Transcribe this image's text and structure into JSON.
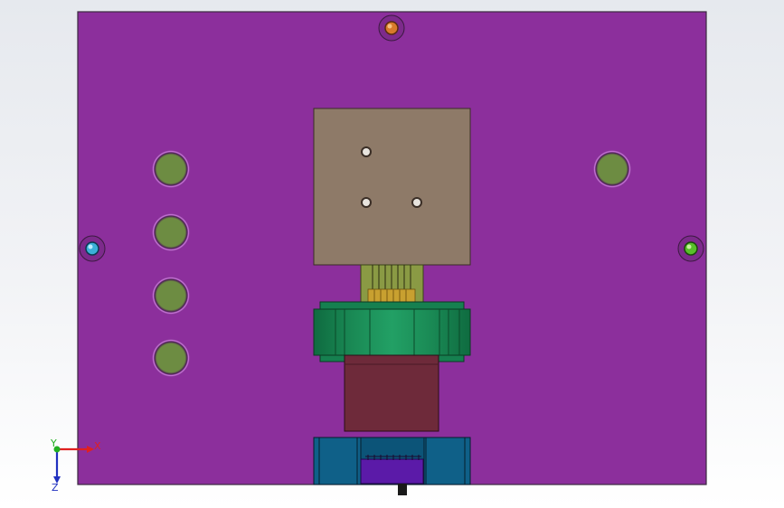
{
  "viewport": {
    "background_top": "#e6e9ee",
    "background_bottom": "#ffffff"
  },
  "part": {
    "plate_color": "#8c2f9c",
    "plate_edge_color": "#3b2a3f",
    "hole_fill_color": "#6d8c42",
    "hole_ring_color": "#c65ed6",
    "block_color": "#8e7a68",
    "connector_color": "#8a9a44",
    "pin_color": "#c8a030",
    "gear_color": "#1a8a55",
    "gear_dark_color": "#0f6b40",
    "housing_color": "#6e2a3a",
    "bottom_block_color": "#0f6088",
    "bottom_slot_color": "#5b1aa8"
  },
  "pins": {
    "top": {
      "color": "#d87a2a",
      "icon": "pin-top-icon"
    },
    "left": {
      "color": "#3ab0d8",
      "icon": "pin-left-icon"
    },
    "right": {
      "color": "#58c02a",
      "icon": "pin-right-icon"
    }
  },
  "triad": {
    "x_label": "X",
    "y_label": "Y",
    "z_label": "Z",
    "x_color": "#e02020",
    "y_color": "#20b020",
    "z_color": "#2030c0"
  }
}
